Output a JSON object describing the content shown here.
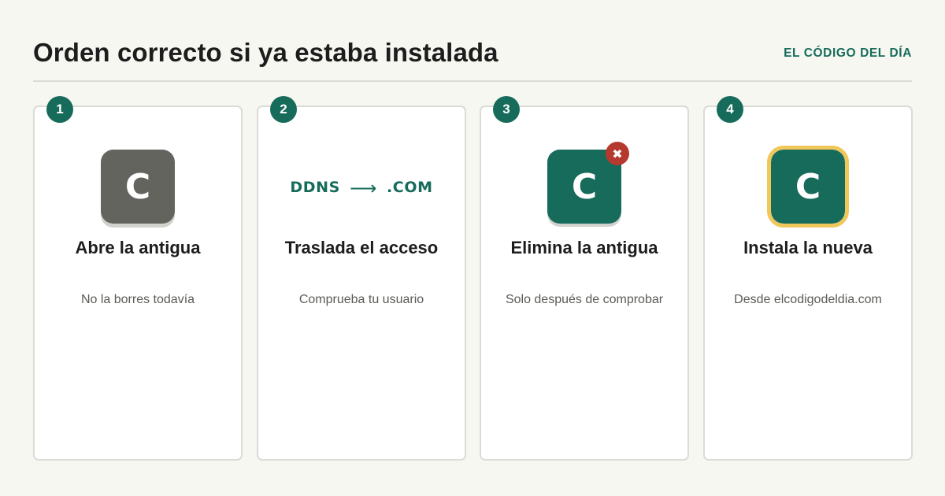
{
  "header": {
    "title": "Orden correcto si ya estaba instalada",
    "brand": "EL CÓDIGO DEL DÍA"
  },
  "colors": {
    "accent": "#176b5b",
    "old_app": "#64645e",
    "remove": "#b5392e",
    "highlight": "#f0c75a"
  },
  "steps": [
    {
      "number": "1",
      "icon_letter": "C",
      "icon": "old-app-icon",
      "title": "Abre la antigua",
      "subtitle": "No la borres todavía"
    },
    {
      "number": "2",
      "from": "DDNS",
      "arrow": "⟶",
      "to": ".COM",
      "title": "Traslada el acceso",
      "subtitle": "Comprueba tu usuario"
    },
    {
      "number": "3",
      "icon_letter": "C",
      "icon": "app-icon-with-remove-badge",
      "remove_glyph": "✖",
      "title": "Elimina la antigua",
      "subtitle": "Solo después de comprobar"
    },
    {
      "number": "4",
      "icon_letter": "C",
      "icon": "new-app-icon",
      "title": "Instala la nueva",
      "subtitle": "Desde elcodigodeldia.com"
    }
  ]
}
